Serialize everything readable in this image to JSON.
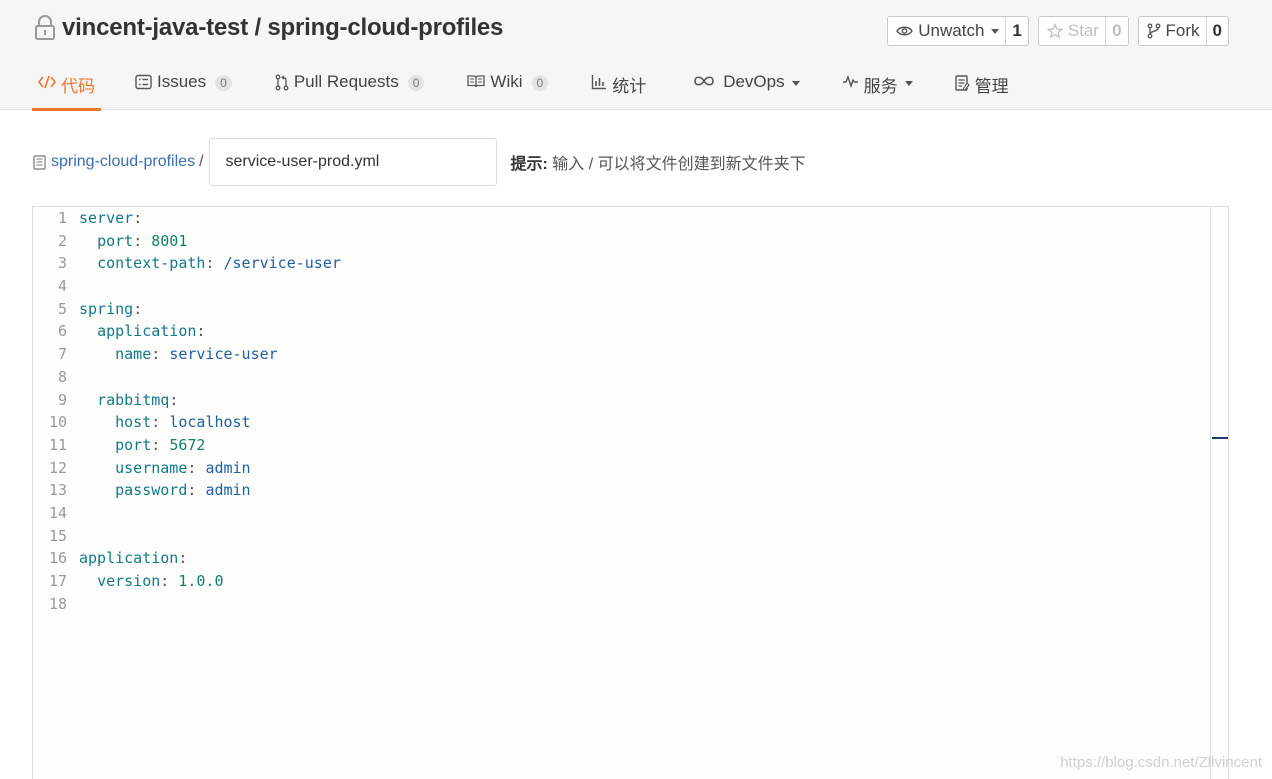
{
  "repo": {
    "owner": "vincent-java-test",
    "separator": " / ",
    "name": "spring-cloud-profiles"
  },
  "actions": {
    "watch": {
      "label": "Unwatch",
      "count": "1"
    },
    "star": {
      "label": "Star",
      "count": "0"
    },
    "fork": {
      "label": "Fork",
      "count": "0"
    }
  },
  "tabs": [
    {
      "label": "代码",
      "icon": "code-icon",
      "active": true
    },
    {
      "label": "Issues",
      "icon": "issues-icon",
      "badge": "0"
    },
    {
      "label": "Pull Requests",
      "icon": "pull-request-icon",
      "badge": "0"
    },
    {
      "label": "Wiki",
      "icon": "book-icon",
      "badge": "0"
    },
    {
      "label": "统计",
      "icon": "chart-icon"
    },
    {
      "label": "DevOps",
      "icon": "infinity-icon"
    },
    {
      "label": "服务",
      "icon": "pulse-icon"
    },
    {
      "label": "管理",
      "icon": "clipboard-icon"
    }
  ],
  "path": {
    "root": "spring-cloud-profiles",
    "separator": "/",
    "filename": "service-user-prod.yml"
  },
  "hint": {
    "label": "提示:",
    "text": " 输入 / 可以将文件创建到新文件夹下"
  },
  "colors": {
    "accent": "#f0762b",
    "link": "#3a6fb2"
  },
  "code_lines": [
    {
      "n": "1",
      "indent": "",
      "key": "server",
      "val": "",
      "type": ""
    },
    {
      "n": "2",
      "indent": "  ",
      "key": "port",
      "val": "8001",
      "type": "num"
    },
    {
      "n": "3",
      "indent": "  ",
      "key": "context-path",
      "val": "/service-user",
      "type": "str"
    },
    {
      "n": "4",
      "indent": "",
      "key": "",
      "val": "",
      "type": ""
    },
    {
      "n": "5",
      "indent": "",
      "key": "spring",
      "val": "",
      "type": ""
    },
    {
      "n": "6",
      "indent": "  ",
      "key": "application",
      "val": "",
      "type": ""
    },
    {
      "n": "7",
      "indent": "    ",
      "key": "name",
      "val": "service-user",
      "type": "str"
    },
    {
      "n": "8",
      "indent": "",
      "key": "",
      "val": "",
      "type": ""
    },
    {
      "n": "9",
      "indent": "  ",
      "key": "rabbitmq",
      "val": "",
      "type": ""
    },
    {
      "n": "10",
      "indent": "    ",
      "key": "host",
      "val": "localhost",
      "type": "str"
    },
    {
      "n": "11",
      "indent": "    ",
      "key": "port",
      "val": "5672",
      "type": "num"
    },
    {
      "n": "12",
      "indent": "    ",
      "key": "username",
      "val": "admin",
      "type": "str"
    },
    {
      "n": "13",
      "indent": "    ",
      "key": "password",
      "val": "admin",
      "type": "str"
    },
    {
      "n": "14",
      "indent": "",
      "key": "",
      "val": "",
      "type": ""
    },
    {
      "n": "15",
      "indent": "",
      "key": "",
      "val": "",
      "type": ""
    },
    {
      "n": "16",
      "indent": "",
      "key": "application",
      "val": "",
      "type": ""
    },
    {
      "n": "17",
      "indent": "  ",
      "key": "version",
      "val": "1.0.0",
      "type": "num"
    },
    {
      "n": "18",
      "indent": "",
      "key": "",
      "val": "",
      "type": ""
    }
  ],
  "watermark": "https://blog.csdn.net/Zllvincent"
}
